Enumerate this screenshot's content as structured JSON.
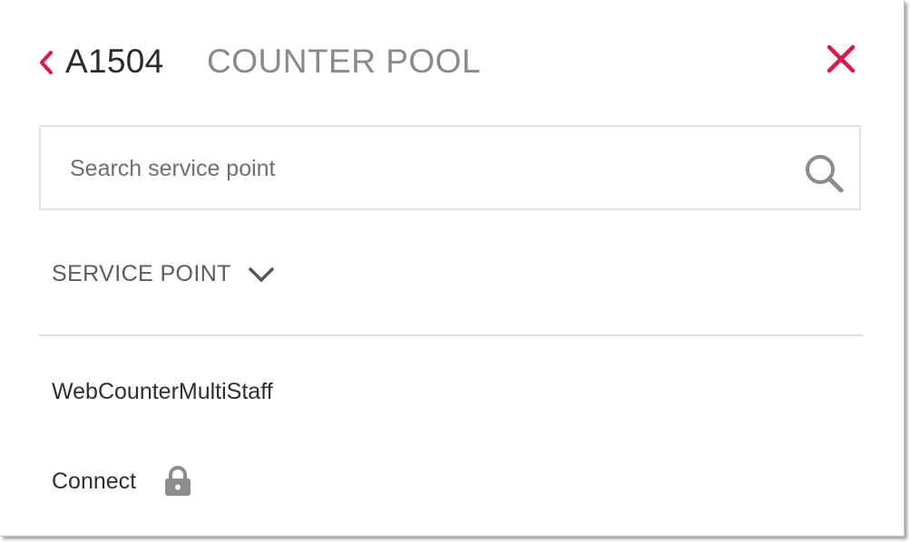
{
  "header": {
    "counter_id": "A1504",
    "section_title": "COUNTER POOL",
    "back_icon": "chevron-left-icon",
    "close_icon": "close-icon"
  },
  "search": {
    "placeholder": "Search service point",
    "value": "",
    "icon": "search-icon"
  },
  "list": {
    "column_header": "SERVICE POINT",
    "sort_icon": "chevron-down-icon",
    "items": [
      {
        "label": "WebCounterMultiStaff",
        "locked": false
      },
      {
        "label": "Connect",
        "locked": true,
        "icon": "lock-icon"
      }
    ]
  },
  "colors": {
    "accent": "#e0174f",
    "title_gray": "#8a8a8a",
    "text_dark": "#2b2b2b",
    "icon_gray": "#8c8c8c",
    "border": "#e2e2e2"
  }
}
